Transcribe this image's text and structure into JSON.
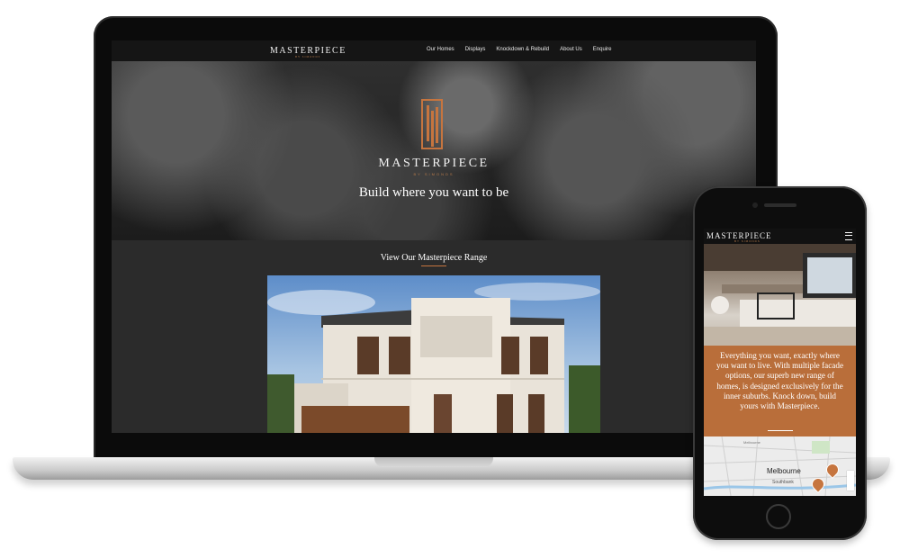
{
  "laptop_site": {
    "nav": {
      "logo": "MASTERPIECE",
      "logo_sub": "BY SIMONDS",
      "links": [
        "Our Homes",
        "Displays",
        "Knockdown & Rebuild",
        "About Us",
        "Enquire"
      ]
    },
    "hero": {
      "brand": "MASTERPIECE",
      "brand_sub": "BY SIMONDS",
      "tagline": "Build where you want to be"
    },
    "range_section": {
      "title": "View Our Masterpiece Range"
    }
  },
  "mobile_site": {
    "nav": {
      "logo": "MASTERPIECE",
      "logo_sub": "BY SIMONDS",
      "menu_icon": "hamburger-menu-icon"
    },
    "copy": "Everything you want, exactly where you want to live. With multiple facade options, our superb new range of homes, is designed exclusively for the inner suburbs. Knock down, build yours with Masterpiece.",
    "map": {
      "city": "Melbourne",
      "suburb_top": "Melbourne",
      "suburb_bottom": "Southbank"
    }
  },
  "colors": {
    "accent": "#c6753f",
    "mobile_copy_bg": "#b96e3a",
    "site_dark": "#2b2b2b"
  }
}
